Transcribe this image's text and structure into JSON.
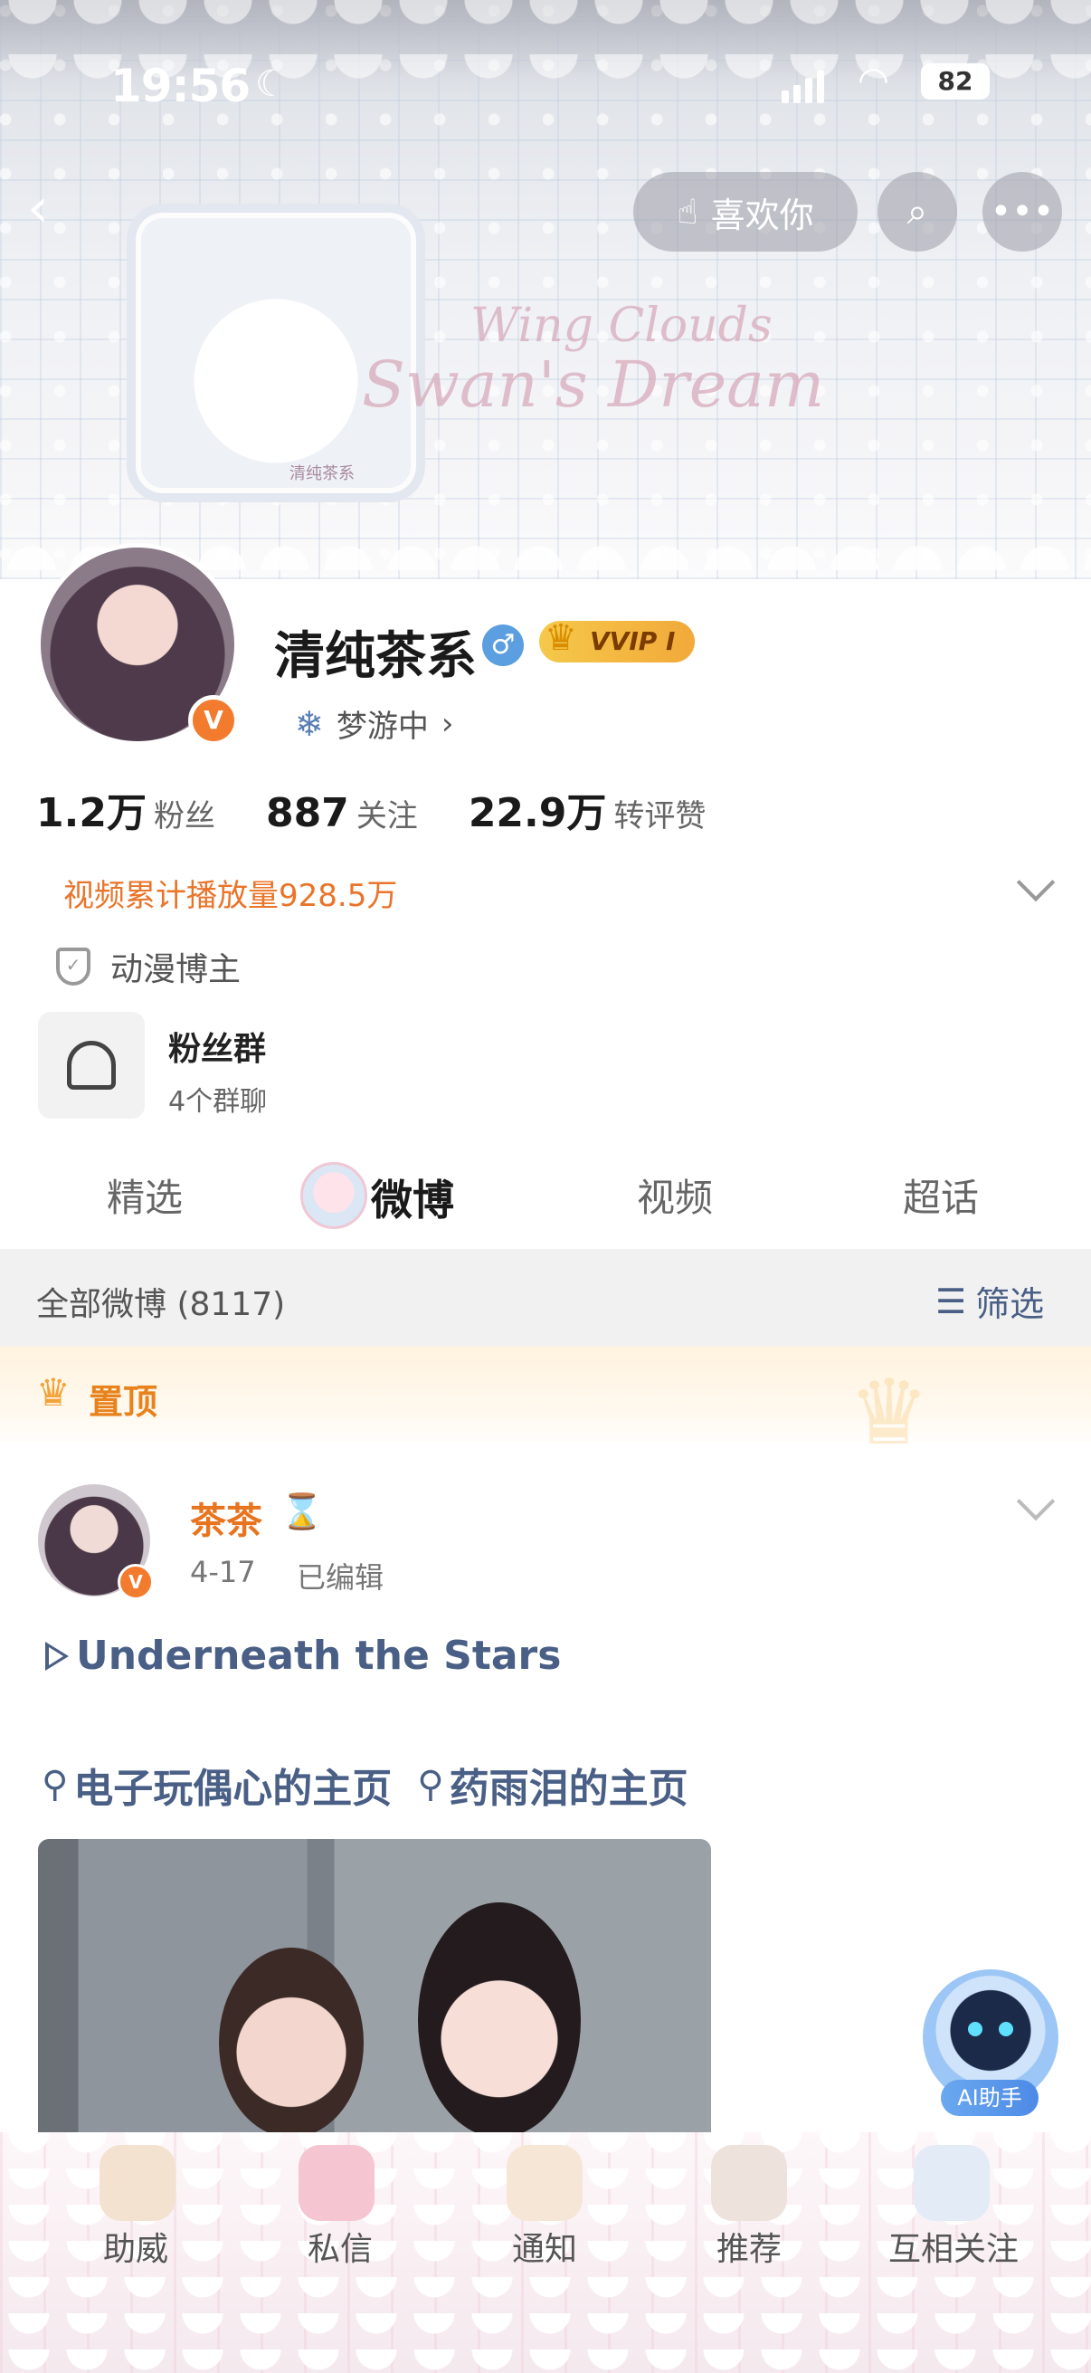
{
  "status_bar": {
    "time": "19:56",
    "battery": "82"
  },
  "header": {
    "like_label": "喜欢你",
    "banner_text_line1": "Wing Clouds",
    "banner_text_line2": "Swan's Dream",
    "banner_watermark": "清纯茶系"
  },
  "profile": {
    "name": "清纯茶系",
    "vip_label": "VVIP I",
    "status_text": "梦游中",
    "stats": [
      {
        "value": "1.2万",
        "label": "粉丝"
      },
      {
        "value": "887",
        "label": "关注"
      },
      {
        "value": "22.9万",
        "label": "转评赞"
      }
    ],
    "video_plays": "视频累计播放量928.5万",
    "category": "动漫博主",
    "fan_group": {
      "title": "粉丝群",
      "subtitle": "4个群聊"
    }
  },
  "tabs": [
    {
      "label": "精选",
      "active": false
    },
    {
      "label": "微博",
      "active": true
    },
    {
      "label": "视频",
      "active": false
    },
    {
      "label": "超话",
      "active": false
    }
  ],
  "feed_header": {
    "all_label": "全部微博 (8117)",
    "filter_label": "筛选"
  },
  "pinned_label": "置顶",
  "post": {
    "author": "茶茶",
    "date": "4-17",
    "edited": "已编辑",
    "link_title": "Underneath the Stars",
    "mentions": [
      "电子玩偶心的主页",
      "药雨泪的主页"
    ]
  },
  "ai_assistant_label": "AI助手",
  "bottom_nav": [
    {
      "label": "助威"
    },
    {
      "label": "私信"
    },
    {
      "label": "通知"
    },
    {
      "label": "推荐"
    },
    {
      "label": "互相关注"
    }
  ],
  "colors": {
    "accent_orange": "#e8741f",
    "link_blue": "#4a5f86",
    "vip_gold": "#f5c84a",
    "verified_badge": "#f27b2d"
  },
  "icons": [
    "back-icon",
    "like-hand-icon",
    "search-icon",
    "more-icon",
    "gender-male-icon",
    "crown-icon",
    "snowflake-icon",
    "chevron-right-icon",
    "chevron-down-icon",
    "shield-icon",
    "group-icon",
    "filter-icon",
    "hourglass-icon",
    "play-icon",
    "person-icon"
  ]
}
